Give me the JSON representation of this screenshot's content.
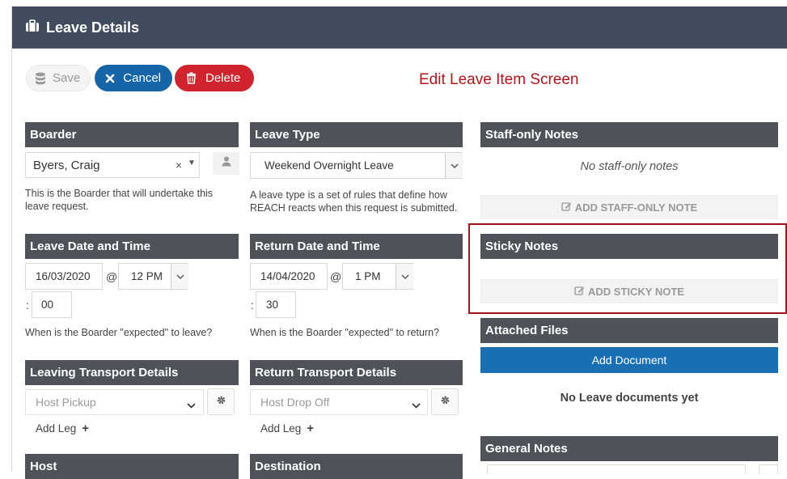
{
  "header": {
    "title": "Leave Details"
  },
  "toolbar": {
    "save": "Save",
    "cancel": "Cancel",
    "delete": "Delete"
  },
  "annotation": "Edit Leave Item Screen",
  "boarder": {
    "heading": "Boarder",
    "value": "Byers, Craig",
    "help": "This is the Boarder that will undertake this leave request."
  },
  "leave_type": {
    "heading": "Leave Type",
    "value": "Weekend Overnight Leave",
    "help": "A leave type is a set of rules that define how REACH reacts when this request is submitted."
  },
  "leave_date": {
    "heading": "Leave Date and Time",
    "date": "16/03/2020",
    "at": "@",
    "hour": "12 PM",
    "colon": ":",
    "minute": "00",
    "help": "When is the Boarder \"expected\" to leave?"
  },
  "return_date": {
    "heading": "Return Date and Time",
    "date": "14/04/2020",
    "at": "@",
    "hour": "1 PM",
    "colon": ":",
    "minute": "30",
    "help": "When is the Boarder \"expected\" to return?"
  },
  "leaving_transport": {
    "heading": "Leaving Transport Details",
    "value": "Host Pickup",
    "add_leg": "Add Leg"
  },
  "return_transport": {
    "heading": "Return Transport Details",
    "value": "Host Drop Off",
    "add_leg": "Add Leg"
  },
  "host": {
    "heading": "Host"
  },
  "destination": {
    "heading": "Destination"
  },
  "staff_notes": {
    "heading": "Staff-only Notes",
    "empty": "No staff-only notes",
    "add": "ADD STAFF-ONLY NOTE"
  },
  "sticky_notes": {
    "heading": "Sticky Notes",
    "add": "ADD STICKY NOTE"
  },
  "attached_files": {
    "heading": "Attached Files",
    "add": "Add Document",
    "empty": "No Leave documents yet"
  },
  "general_notes": {
    "heading": "General Notes"
  }
}
